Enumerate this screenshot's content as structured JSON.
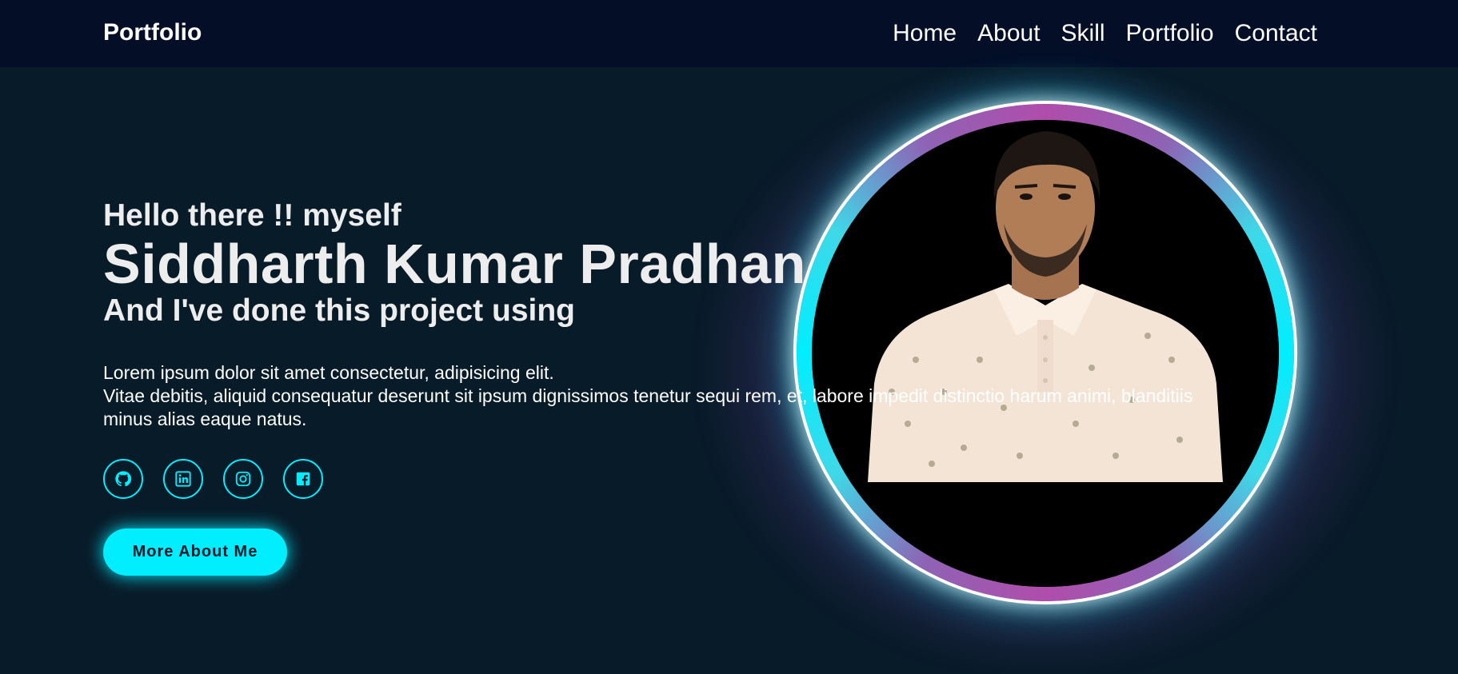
{
  "navbar": {
    "logo": "Portfolio",
    "links": [
      "Home",
      "About",
      "Skill",
      "Portfolio",
      "Contact"
    ]
  },
  "hero": {
    "greeting": "Hello there !! myself",
    "name": "Siddharth Kumar Pradhan",
    "subtitle": "And I've done this project using",
    "desc_line1": "Lorem ipsum dolor sit amet consectetur, adipisicing elit.",
    "desc_line2": "Vitae debitis, aliquid consequatur deserunt sit ipsum dignissimos tenetur sequi rem, et, labore impedit distinctio harum animi, blanditiis",
    "desc_line3": "minus alias eaque natus.",
    "cta": "More About Me"
  },
  "socials": [
    "github-icon",
    "linkedin-icon",
    "instagram-icon",
    "facebook-icon"
  ],
  "colors": {
    "accent": "#00eeff",
    "background": "#081b29",
    "navbar": "#040f27",
    "ring_purple": "#b04dab"
  }
}
